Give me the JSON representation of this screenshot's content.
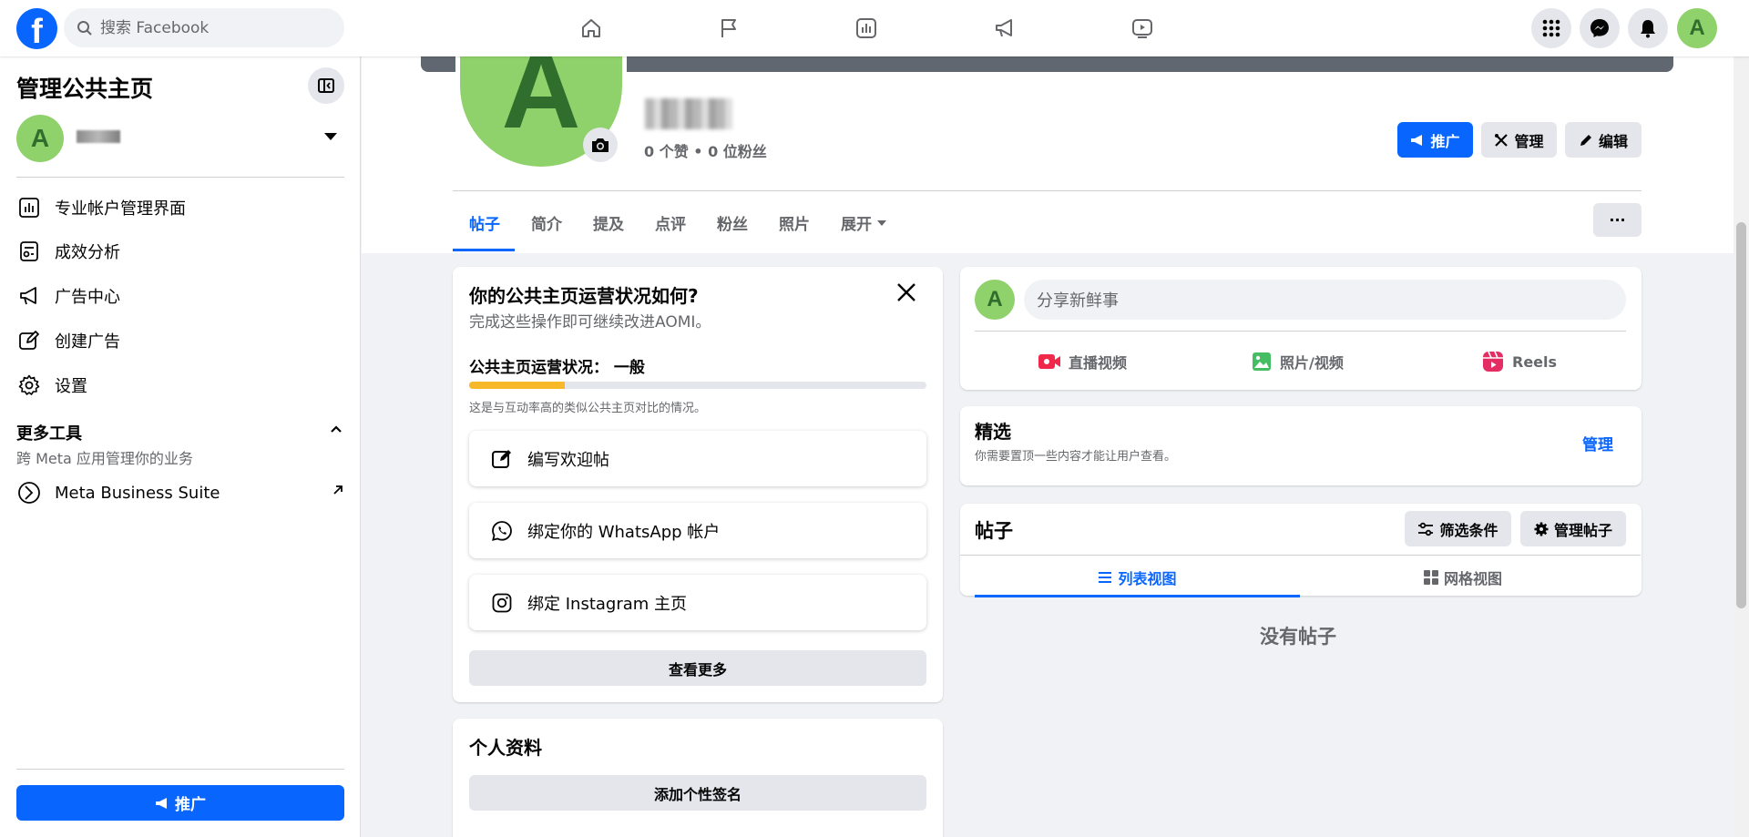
{
  "topbar": {
    "logo_letter": "f",
    "search_placeholder": "搜索 Facebook",
    "user_initial": "A"
  },
  "sidebar": {
    "title": "管理公共主页",
    "page_initial": "A",
    "items": [
      {
        "label": "专业帐户管理界面",
        "icon": "dashboard-icon"
      },
      {
        "label": "成效分析",
        "icon": "insights-icon"
      },
      {
        "label": "广告中心",
        "icon": "megaphone-icon"
      },
      {
        "label": "创建广告",
        "icon": "edit-icon"
      },
      {
        "label": "设置",
        "icon": "gear-icon"
      }
    ],
    "more_tools": {
      "title": "更多工具",
      "subtitle": "跨 Meta 应用管理你的业务"
    },
    "meta_business_suite": "Meta Business Suite",
    "promote_label": "推广"
  },
  "profile": {
    "initial": "A",
    "stats": "0 个赞 • 0 位粉丝",
    "buttons": {
      "promote": "推广",
      "manage": "管理",
      "edit": "编辑"
    },
    "tabs": [
      "帖子",
      "简介",
      "提及",
      "点评",
      "粉丝",
      "照片",
      "展开"
    ],
    "more_label": "···"
  },
  "health": {
    "title": "你的公共主页运营状况如何?",
    "subtitle": "完成这些操作即可继续改进AOMI。",
    "status": "公共主页运营状况：  一般",
    "progress": 0.21,
    "benchmark": "这是与互动率高的类似公共主页对比的情况。",
    "tasks": [
      "编写欢迎帖",
      "绑定你的 WhatsApp 帐户",
      "绑定 Instagram 主页"
    ],
    "see_more": "查看更多"
  },
  "bio": {
    "title": "个人资料",
    "add_bio": "添加个性签名"
  },
  "composer": {
    "initial": "A",
    "placeholder": "分享新鲜事",
    "actions": [
      "直播视频",
      "照片/视频",
      "Reels"
    ]
  },
  "featured": {
    "title": "精选",
    "subtitle": "你需要置顶一些内容才能让用户查看。",
    "manage": "管理"
  },
  "posts": {
    "title": "帖子",
    "filter": "筛选条件",
    "manage": "管理帖子",
    "list_view": "列表视图",
    "grid_view": "网格视图",
    "empty": "没有帖子"
  },
  "colors": {
    "brand": "#0866ff",
    "avatar": "#8fd16a",
    "progress": "#f7b928"
  }
}
